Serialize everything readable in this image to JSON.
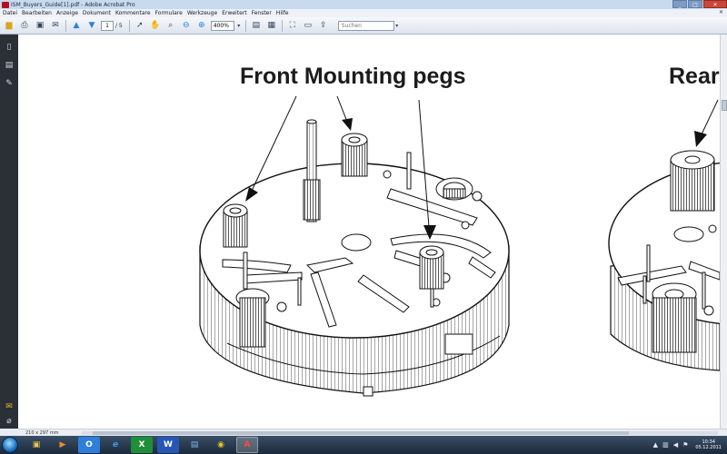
{
  "window": {
    "title": "ISM_Buyers_Guide[1].pdf - Adobe Acrobat Pro",
    "controls": [
      "_",
      "□",
      "✕"
    ]
  },
  "menu": {
    "items": [
      "Datei",
      "Bearbeiten",
      "Anzeige",
      "Dokument",
      "Kommentare",
      "Formulare",
      "Werkzeuge",
      "Erweitert",
      "Fenster",
      "Hilfe"
    ],
    "close_glyph": "✕"
  },
  "toolbar": {
    "current_page": "1",
    "total_pages": "/ 5",
    "zoom": "400%",
    "search_placeholder": "Suchen"
  },
  "document": {
    "headline": "Front Mounting pegs",
    "headline_right": "Rear"
  },
  "statusbar": {
    "page_size": "210 x 297 mm"
  },
  "taskbar": {
    "clock_time": "10:34",
    "clock_date": "05.12.2011",
    "apps": [
      {
        "name": "explorer",
        "glyph": "▣",
        "color": "#f0c24a"
      },
      {
        "name": "media-player",
        "glyph": "▶",
        "color": "#f08a2a"
      },
      {
        "name": "outlook",
        "glyph": "O",
        "color": "#2f7fd8"
      },
      {
        "name": "internet-explorer",
        "glyph": "e",
        "color": "#3aa0ea"
      },
      {
        "name": "excel",
        "glyph": "X",
        "color": "#1f8f3a"
      },
      {
        "name": "word",
        "glyph": "W",
        "color": "#2757b5"
      },
      {
        "name": "window-switcher",
        "glyph": "▤",
        "color": "#7fb6e6"
      },
      {
        "name": "chrome",
        "glyph": "◉",
        "color": "#e4c42a"
      },
      {
        "name": "acrobat",
        "glyph": "A",
        "color": "#c41a1a"
      }
    ]
  },
  "colors": {
    "acrobat_red": "#b3121b",
    "document_bg": "#ffffff",
    "taskbar": "#1c2a3c"
  }
}
